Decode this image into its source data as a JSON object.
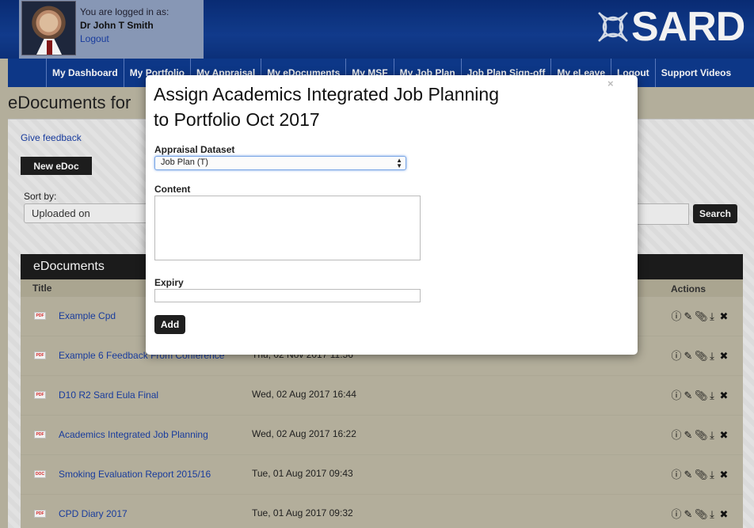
{
  "header": {
    "logged_in_label": "You are logged in as:",
    "user_name": "Dr John T Smith",
    "logout_link": "Logout",
    "logo_text": "SARD"
  },
  "nav": {
    "items": [
      "My Dashboard",
      "My Portfolio",
      "My Appraisal",
      "My eDocuments",
      "My MSF",
      "My Job Plan",
      "Job Plan Sign-off",
      "My eLeave",
      "Logout",
      "Support Videos"
    ]
  },
  "page": {
    "title": "eDocuments for",
    "feedback_link": "Give feedback",
    "new_button": "New eDoc",
    "sort_label": "Sort by:",
    "sort_value": "Uploaded on",
    "search_button": "Search"
  },
  "docs": {
    "heading": "eDocuments",
    "col_title": "Title",
    "col_actions": "Actions",
    "rows": [
      {
        "title": "Example Cpd",
        "date": "",
        "icon": "pdf-icon"
      },
      {
        "title": "Example 6 Feedback From Conference",
        "date": "Thu, 02 Nov 2017 11:56",
        "icon": "pdf-icon"
      },
      {
        "title": "D10 R2 Sard Eula Final",
        "date": "Wed, 02 Aug 2017 16:44",
        "icon": "pdf-icon"
      },
      {
        "title": "Academics Integrated Job Planning",
        "date": "Wed, 02 Aug 2017 16:22",
        "icon": "pdf-icon"
      },
      {
        "title": "Smoking Evaluation Report 2015/16",
        "date": "Tue, 01 Aug 2017 09:43",
        "icon": "doc-icon"
      },
      {
        "title": "CPD Diary 2017",
        "date": "Tue, 01 Aug 2017 09:32",
        "icon": "pdf-icon"
      }
    ]
  },
  "modal": {
    "close": "×",
    "title_line1": "Assign Academics Integrated Job Planning",
    "title_line2": "to Portfolio Oct 2017",
    "dataset_label": "Appraisal Dataset",
    "dataset_value": "Job Plan (T)",
    "content_label": "Content",
    "expiry_label": "Expiry",
    "add_button": "Add"
  }
}
